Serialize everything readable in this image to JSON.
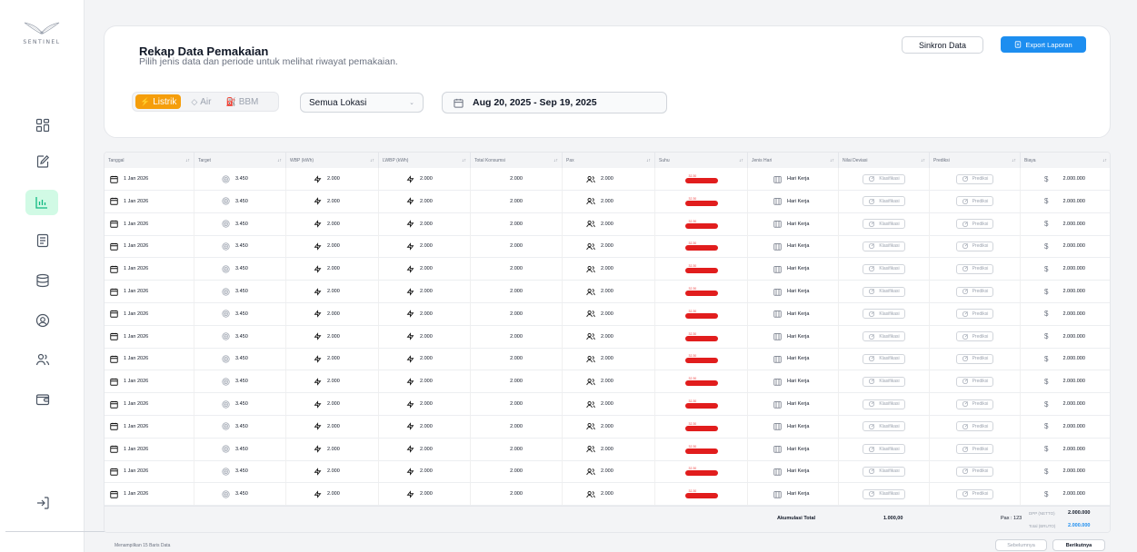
{
  "logo": {
    "text": "SENTINEL"
  },
  "header": {
    "title": "Rekap Data Pemakaian",
    "subtitle": "Pilih jenis data dan periode untuk melihat riwayat pemakaian.",
    "sync_label": "Sinkron Data",
    "export_label": "Export Laporan"
  },
  "type_toggle": {
    "listrik": "Listrik",
    "air": "Air",
    "bbm": "BBM"
  },
  "location_select": {
    "value": "Semua Lokasi"
  },
  "date_range": {
    "value": "Aug 20, 2025 - Sep 19, 2025"
  },
  "table": {
    "columns": [
      "Tanggal",
      "Target",
      "WBP (kWh)",
      "LWBP (kWh)",
      "Total Konsumsi",
      "Pax",
      "Suhu",
      "Jenis Hari",
      "Nilai Deviasi",
      "Prediksi",
      "Biaya"
    ],
    "rows": [
      {
        "date": "1 Jan 2026",
        "target": "3.450",
        "wbp": "2.000",
        "lwbp": "2.000",
        "total": "2.000",
        "pax": "2.000",
        "suhu": "32.30",
        "jenis_hari": "Hari Kerja",
        "deviasi": "Klasifikasi",
        "prediksi": "Prediksi",
        "biaya": "2.000.000"
      },
      {
        "date": "1 Jan 2026",
        "target": "3.450",
        "wbp": "2.000",
        "lwbp": "2.000",
        "total": "2.000",
        "pax": "2.000",
        "suhu": "32.30",
        "jenis_hari": "Hari Kerja",
        "deviasi": "Klasifikasi",
        "prediksi": "Prediksi",
        "biaya": "2.000.000"
      },
      {
        "date": "1 Jan 2026",
        "target": "3.450",
        "wbp": "2.000",
        "lwbp": "2.000",
        "total": "2.000",
        "pax": "2.000",
        "suhu": "32.30",
        "jenis_hari": "Hari Kerja",
        "deviasi": "Klasifikasi",
        "prediksi": "Prediksi",
        "biaya": "2.000.000"
      },
      {
        "date": "1 Jan 2026",
        "target": "3.450",
        "wbp": "2.000",
        "lwbp": "2.000",
        "total": "2.000",
        "pax": "2.000",
        "suhu": "32.30",
        "jenis_hari": "Hari Kerja",
        "deviasi": "Klasifikasi",
        "prediksi": "Prediksi",
        "biaya": "2.000.000"
      },
      {
        "date": "1 Jan 2026",
        "target": "3.450",
        "wbp": "2.000",
        "lwbp": "2.000",
        "total": "2.000",
        "pax": "2.000",
        "suhu": "32.30",
        "jenis_hari": "Hari Kerja",
        "deviasi": "Klasifikasi",
        "prediksi": "Prediksi",
        "biaya": "2.000.000"
      },
      {
        "date": "1 Jan 2026",
        "target": "3.450",
        "wbp": "2.000",
        "lwbp": "2.000",
        "total": "2.000",
        "pax": "2.000",
        "suhu": "32.30",
        "jenis_hari": "Hari Kerja",
        "deviasi": "Klasifikasi",
        "prediksi": "Prediksi",
        "biaya": "2.000.000"
      },
      {
        "date": "1 Jan 2026",
        "target": "3.450",
        "wbp": "2.000",
        "lwbp": "2.000",
        "total": "2.000",
        "pax": "2.000",
        "suhu": "32.30",
        "jenis_hari": "Hari Kerja",
        "deviasi": "Klasifikasi",
        "prediksi": "Prediksi",
        "biaya": "2.000.000"
      },
      {
        "date": "1 Jan 2026",
        "target": "3.450",
        "wbp": "2.000",
        "lwbp": "2.000",
        "total": "2.000",
        "pax": "2.000",
        "suhu": "32.30",
        "jenis_hari": "Hari Kerja",
        "deviasi": "Klasifikasi",
        "prediksi": "Prediksi",
        "biaya": "2.000.000"
      },
      {
        "date": "1 Jan 2026",
        "target": "3.450",
        "wbp": "2.000",
        "lwbp": "2.000",
        "total": "2.000",
        "pax": "2.000",
        "suhu": "32.30",
        "jenis_hari": "Hari Kerja",
        "deviasi": "Klasifikasi",
        "prediksi": "Prediksi",
        "biaya": "2.000.000"
      },
      {
        "date": "1 Jan 2026",
        "target": "3.450",
        "wbp": "2.000",
        "lwbp": "2.000",
        "total": "2.000",
        "pax": "2.000",
        "suhu": "32.30",
        "jenis_hari": "Hari Kerja",
        "deviasi": "Klasifikasi",
        "prediksi": "Prediksi",
        "biaya": "2.000.000"
      },
      {
        "date": "1 Jan 2026",
        "target": "3.450",
        "wbp": "2.000",
        "lwbp": "2.000",
        "total": "2.000",
        "pax": "2.000",
        "suhu": "32.30",
        "jenis_hari": "Hari Kerja",
        "deviasi": "Klasifikasi",
        "prediksi": "Prediksi",
        "biaya": "2.000.000"
      },
      {
        "date": "1 Jan 2026",
        "target": "3.450",
        "wbp": "2.000",
        "lwbp": "2.000",
        "total": "2.000",
        "pax": "2.000",
        "suhu": "32.30",
        "jenis_hari": "Hari Kerja",
        "deviasi": "Klasifikasi",
        "prediksi": "Prediksi",
        "biaya": "2.000.000"
      },
      {
        "date": "1 Jan 2026",
        "target": "3.450",
        "wbp": "2.000",
        "lwbp": "2.000",
        "total": "2.000",
        "pax": "2.000",
        "suhu": "32.30",
        "jenis_hari": "Hari Kerja",
        "deviasi": "Klasifikasi",
        "prediksi": "Prediksi",
        "biaya": "2.000.000"
      },
      {
        "date": "1 Jan 2026",
        "target": "3.450",
        "wbp": "2.000",
        "lwbp": "2.000",
        "total": "2.000",
        "pax": "2.000",
        "suhu": "32.30",
        "jenis_hari": "Hari Kerja",
        "deviasi": "Klasifikasi",
        "prediksi": "Prediksi",
        "biaya": "2.000.000"
      },
      {
        "date": "1 Jan 2026",
        "target": "3.450",
        "wbp": "2.000",
        "lwbp": "2.000",
        "total": "2.000",
        "pax": "2.000",
        "suhu": "32.30",
        "jenis_hari": "Hari Kerja",
        "deviasi": "Klasifikasi",
        "prediksi": "Prediksi",
        "biaya": "2.000.000"
      }
    ],
    "footer": {
      "akumulasi_label": "Akumulasi Total",
      "total_value": "1.000,00",
      "pax_value": "Pax : 123",
      "dpp_label": "DPP (NETTO)",
      "dpp_value": "2.000.000",
      "bruto_label": "Total (BRUTO)",
      "bruto_value": "2.000.000"
    }
  },
  "pagination": {
    "info": "Menampilkan 15 Baris Data",
    "prev": "Sebelumnya",
    "next": "Berikutnya"
  },
  "colors": {
    "accent_orange": "#f59e0b",
    "export_blue": "#1d8ef0",
    "active_nav_bg": "#d1fae5",
    "active_nav_icon": "#10b981",
    "suhu_red": "#e11d1d",
    "bruto_blue": "#1d8ef0"
  }
}
